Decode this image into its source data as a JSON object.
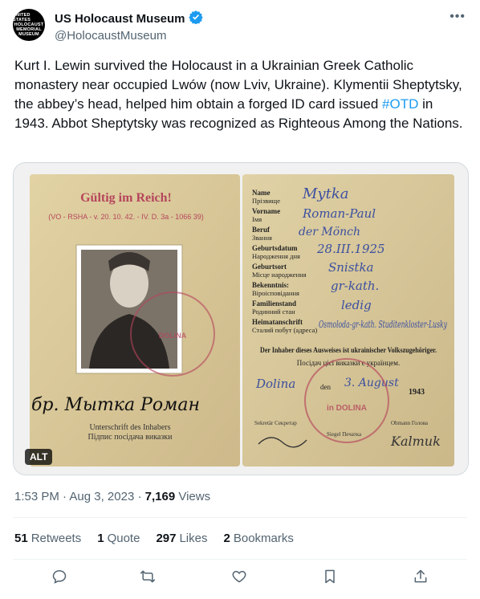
{
  "account": {
    "name": "US Holocaust Museum",
    "handle": "@HolocaustMuseum",
    "avatar_lines": [
      "UNITED STATES",
      "HOLOCAUST",
      "MEMORIAL",
      "MUSEUM"
    ]
  },
  "tweet": {
    "text_before": "Kurt I. Lewin survived the Holocaust in a Ukrainian Greek Catholic monastery near occupied Lwów (now Lviv, Ukraine). Klymentii Sheptytsky, the abbey’s head, helped him obtain a forged ID card issued ",
    "hashtag": "#OTD",
    "text_after": " in 1943. Abbot Sheptytsky was recognized as Righteous Among the Nations."
  },
  "media": {
    "alt_badge": "ALT",
    "document": {
      "stamp_title": "Gültig im Reich!",
      "reference": "(VO - RSHA - v. 20. 10. 42. - IV. D. 3a - 1066 39)",
      "signature": "бр. Мытка Роман",
      "signature_caption_de": "Unterschrift des Inhabers",
      "signature_caption_ua": "Підпис посідача виказки",
      "fields": [
        {
          "label_de": "Name",
          "label_ua": "Прізвище",
          "value": "Mytka"
        },
        {
          "label_de": "Vorname",
          "label_ua": "Імя",
          "value": "Roman-Paul"
        },
        {
          "label_de": "Beruf",
          "label_ua": "Звання",
          "value": "der Mönch"
        },
        {
          "label_de": "Geburtsdatum",
          "label_ua": "Народження дня",
          "value": "28.III.1925"
        },
        {
          "label_de": "Geburtsort",
          "label_ua": "Місце народження",
          "value": "Snistka"
        },
        {
          "label_de": "Bekenntnis:",
          "label_ua": "Віроісповідання",
          "value": "gr-kath."
        },
        {
          "label_de": "Familienstand",
          "label_ua": "Родинний стан",
          "value": "ledig"
        },
        {
          "label_de": "Heimatanschrift",
          "label_ua": "Сталий побут (адреса)",
          "value": "Osmoloda-gr-kath. Studitenkloster-Lusky"
        }
      ],
      "notice_de": "Der Inhaber dieses Ausweises ist ukrainischer Volkszugehöriger.",
      "notice_ua": "Посідач цієї виказки є українцем.",
      "place": "Dolina",
      "date_label": "den",
      "date_value": "3. August",
      "year": "1943",
      "stamp_text": "in DOLINA",
      "footer_labels": [
        "Sekretär Секретар",
        "Siegel Печатка",
        "Obmann Голова"
      ],
      "signature_right": "Kalmuk"
    }
  },
  "meta": {
    "time": "1:53 PM",
    "separator": "·",
    "date": "Aug 3, 2023",
    "views_count": "7,169",
    "views_label": "Views"
  },
  "stats": {
    "retweets": {
      "count": "51",
      "label": "Retweets"
    },
    "quotes": {
      "count": "1",
      "label": "Quote"
    },
    "likes": {
      "count": "297",
      "label": "Likes"
    },
    "bookmarks": {
      "count": "2",
      "label": "Bookmarks"
    }
  },
  "icons": {
    "verified": "verified-badge-icon",
    "more": "more-icon",
    "reply": "reply-icon",
    "retweet": "retweet-icon",
    "like": "heart-icon",
    "bookmark": "bookmark-icon",
    "share": "share-icon"
  },
  "colors": {
    "accent": "#1d9bf0",
    "text": "#0f1419",
    "muted": "#536471",
    "paper": "#d9c99a",
    "stamp_red": "#b5455c",
    "ink_blue": "#3b4fa0"
  }
}
